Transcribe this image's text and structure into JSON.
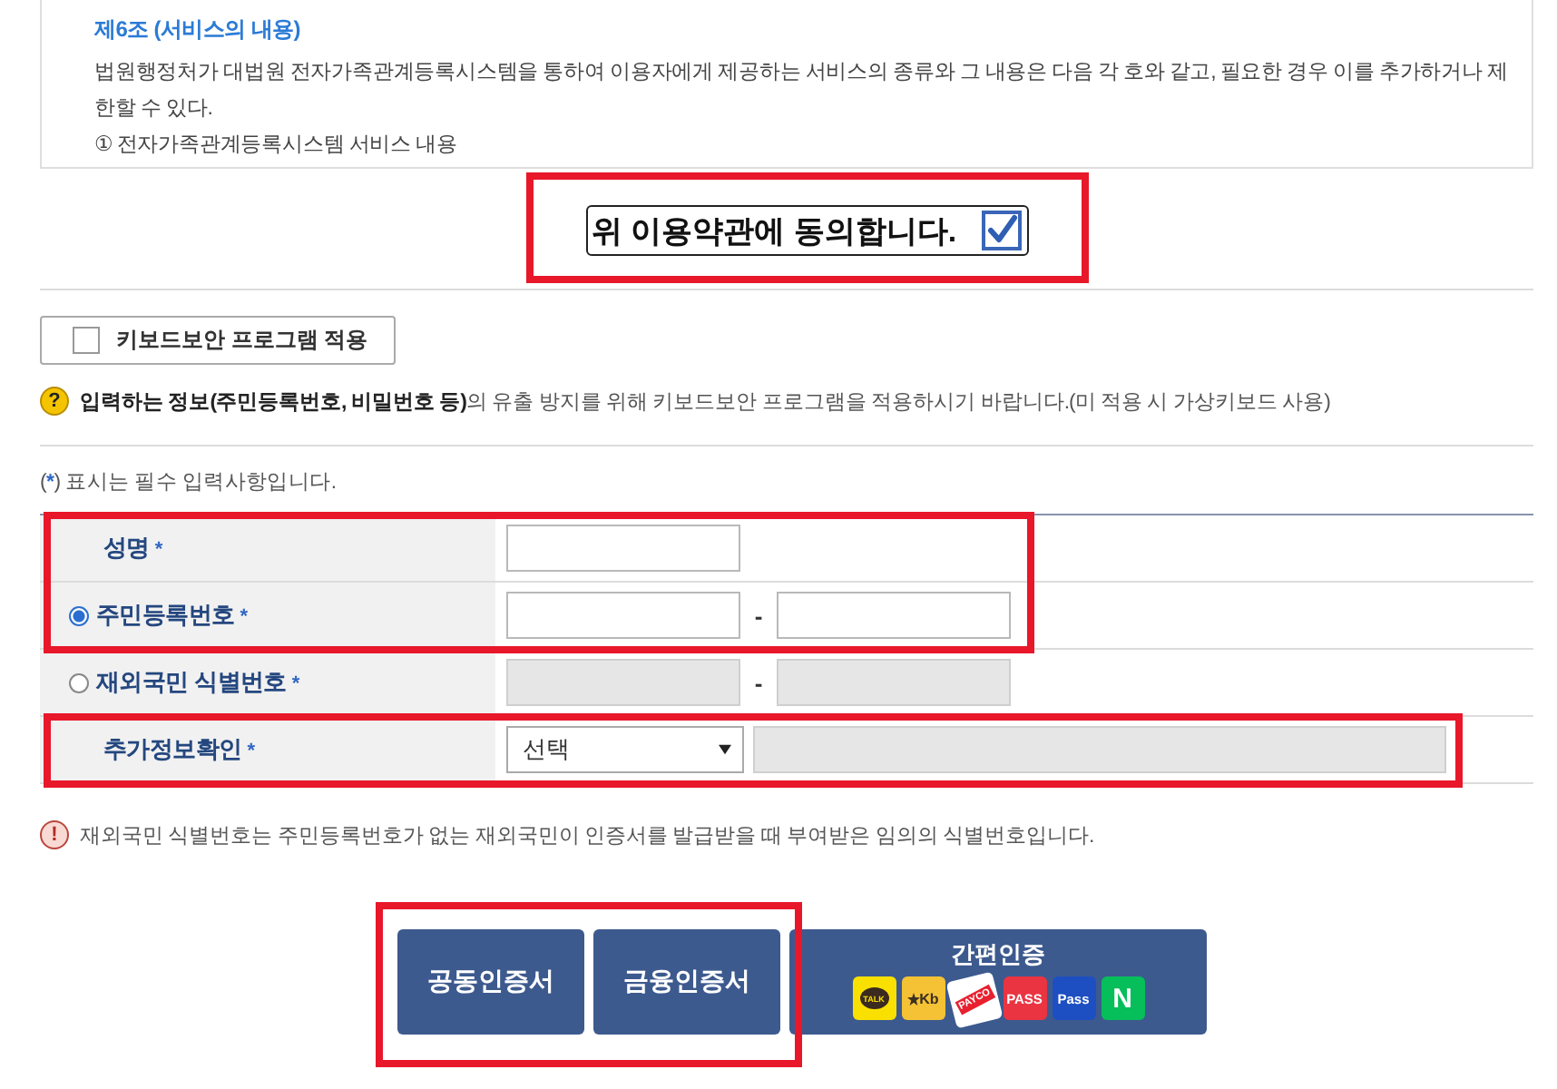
{
  "terms": {
    "heading": "제6조 (서비스의 내용)",
    "body": "법원행정처가 대법원 전자가족관계등록시스템을 통하여 이용자에게 제공하는 서비스의 종류와 그 내용은 다음 각 호와 같고, 필요한 경우 이를 추가하거나 제한할 수 있다.",
    "item": "① 전자가족관계등록시스템 서비스 내용"
  },
  "consent": {
    "label": "위 이용약관에 동의합니다.",
    "checked": true,
    "highlighted": true
  },
  "keyboard_security": {
    "label": "키보드보안 프로그램 적용",
    "checked": false
  },
  "keyboard_notice": {
    "icon": "?",
    "text": "**입력하는 정보(주민등록번호, 비밀번호 등)**의 유출 방지를 위해 키보드보안 프로그램을 적용하시기 바랍니다.(미 적용 시 가상키보드 사용)"
  },
  "required_legend": {
    "open": "(",
    "mark": "*",
    "text": ") 표시는 필수 입력사항입니다."
  },
  "form": {
    "rows": [
      {
        "kind": "single",
        "label": "성명",
        "mark": "*",
        "disabled": false,
        "highlighted": true
      },
      {
        "kind": "split",
        "label": "주민등록번호",
        "mark": "*",
        "selected": true,
        "separator": "-",
        "disabled": false,
        "highlighted": true
      },
      {
        "kind": "split",
        "label": "재외국민 식별번호",
        "mark": "*",
        "selected": false,
        "separator": "-",
        "disabled": true,
        "highlighted": false
      },
      {
        "kind": "select",
        "label": "추가정보확인",
        "mark": "*",
        "value": "선택",
        "disabled": true,
        "highlighted": true
      }
    ]
  },
  "note": {
    "icon": "!",
    "text": "재외국민 식별번호는 주민등록번호가 없는 재외국민이 인증서를 발급받을 때 부여받은 임의의 식별번호입니다."
  },
  "auth_buttons": [
    {
      "kind": "plain",
      "label": "공동인증서",
      "highlighted": true
    },
    {
      "kind": "plain",
      "label": "금융인증서",
      "highlighted": true
    },
    {
      "kind": "easy",
      "label": "간편인증",
      "highlighted": false,
      "providers": [
        {
          "kind": "bubble",
          "mark": "TALK",
          "color": "#f9e000"
        },
        {
          "kind": "star",
          "mark": "Kb",
          "color": "#f4c234"
        },
        {
          "kind": "stamp",
          "mark": "PAYCO",
          "color": "#ffffff"
        },
        {
          "kind": "plain",
          "mark": "PASS",
          "color": "#ea3441"
        },
        {
          "kind": "plain",
          "mark": "Pass",
          "color": "#1d4fc2"
        },
        {
          "kind": "plain",
          "mark": "N",
          "color": "#06be5a"
        }
      ]
    }
  ]
}
